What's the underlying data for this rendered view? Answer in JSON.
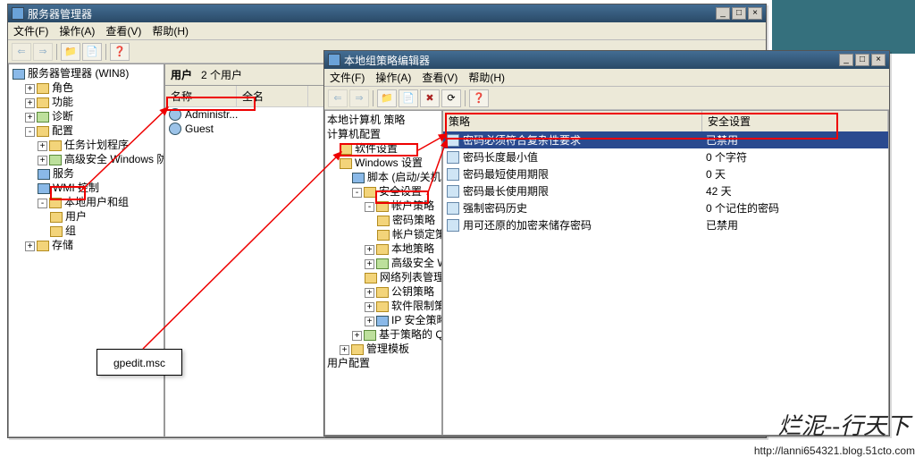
{
  "server_mgr": {
    "title": "服务器管理器",
    "menus": [
      "文件(F)",
      "操作(A)",
      "查看(V)",
      "帮助(H)"
    ],
    "root": "服务器管理器 (WIN8)",
    "nodes": {
      "roles": "角色",
      "features": "功能",
      "diag": "诊断",
      "config": "配置",
      "tasksched": "任务计划程序",
      "advfw": "高级安全 Windows 防火",
      "services": "服务",
      "wmi": "WMI 控制",
      "localusers": "本地用户和组",
      "users": "用户",
      "groups": "组",
      "storage": "存储"
    },
    "userpanel": {
      "header_title": "用户",
      "header_count": "2 个用户",
      "col_name": "名称",
      "col_fullname": "全名",
      "rows": [
        "Administr...",
        "Guest"
      ]
    }
  },
  "gpedit": {
    "title": "本地组策略编辑器",
    "menus": [
      "文件(F)",
      "操作(A)",
      "查看(V)",
      "帮助(H)"
    ],
    "tree": {
      "root": "本地计算机 策略",
      "comp": "计算机配置",
      "sw": "软件设置",
      "winset": "Windows 设置",
      "scripts": "脚本 (启动/关机)",
      "sec": "安全设置",
      "acct": "帐户策略",
      "pwd": "密码策略",
      "lockout": "帐户锁定策略",
      "local": "本地策略",
      "advfw": "高级安全 Windows",
      "netlist": "网络列表管理器策",
      "pubkey": "公钥策略",
      "swrestrict": "软件限制策略",
      "ipsec": "IP 安全策略，在",
      "qos": "基于策略的 QoS",
      "admtmpl": "管理模板",
      "userconf": "用户配置"
    },
    "policies": {
      "col_policy": "策略",
      "col_setting": "安全设置",
      "rows": [
        {
          "name": "密码必须符合复杂性要求",
          "val": "已禁用"
        },
        {
          "name": "密码长度最小值",
          "val": "0 个字符"
        },
        {
          "name": "密码最短使用期限",
          "val": "0 天"
        },
        {
          "name": "密码最长使用期限",
          "val": "42 天"
        },
        {
          "name": "强制密码历史",
          "val": "0 个记住的密码"
        },
        {
          "name": "用可还原的加密来储存密码",
          "val": "已禁用"
        }
      ]
    }
  },
  "callout": "gpedit.msc",
  "watermark": "烂泥--行天下",
  "blog": "http://lanni654321.blog.51cto.com"
}
